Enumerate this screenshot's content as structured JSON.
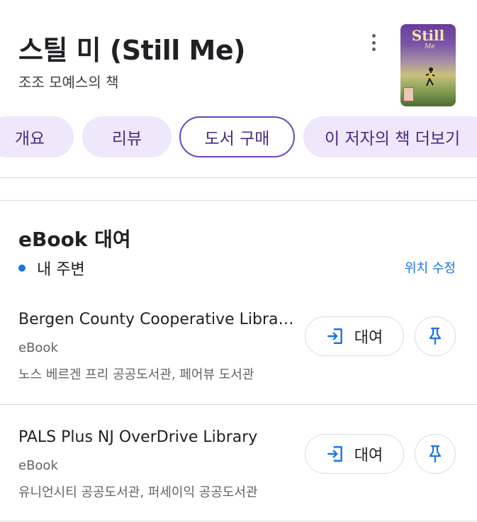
{
  "header": {
    "title": "스틸 미 (Still Me)",
    "author_line": "조조 모예스의 책"
  },
  "cover": {
    "title_text": "Still",
    "subtitle_text": "Me"
  },
  "tabs": [
    {
      "label": "개요"
    },
    {
      "label": "리뷰"
    },
    {
      "label": "도서 구매",
      "selected": true
    },
    {
      "label": "이 저자의 책 더보기"
    }
  ],
  "ebook_section": {
    "title": "eBook 대여",
    "location_label": "내 주변",
    "edit_location_label": "위치 수정"
  },
  "libraries": [
    {
      "name": "Bergen County Cooperative Library System",
      "type": "eBook",
      "branches": "노스 베르겐 프리 공공도서관, 페어뷰 도서관",
      "borrow_label": "대여"
    },
    {
      "name": "PALS Plus NJ OverDrive Library",
      "type": "eBook",
      "branches": "유니언시티 공공도서관, 퍼세이익 공공도서관",
      "borrow_label": "대여"
    }
  ],
  "colors": {
    "accent": "#1a73e8",
    "chip_bg": "#efe7fa",
    "chip_text": "#4a2a86",
    "chip_active_border": "#6a44c4"
  },
  "icons": {
    "more": "more-vert-icon",
    "borrow": "login-arrow-icon",
    "pin": "pushpin-icon"
  }
}
